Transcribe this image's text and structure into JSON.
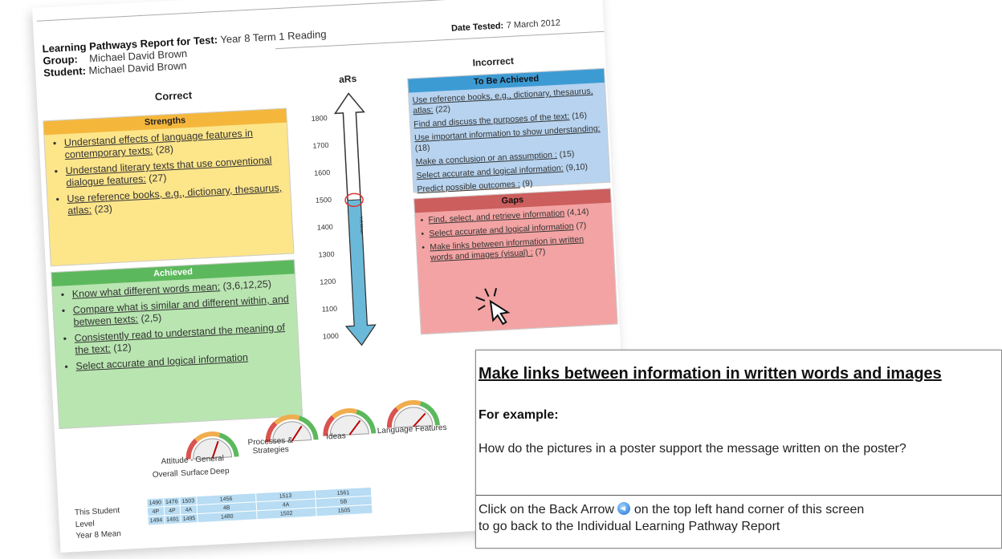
{
  "report": {
    "title_label": "Learning Pathways Report for Test:",
    "title_value": "Year 8 Term 1 Reading",
    "date_label": "Date Tested:",
    "date_value": "7 March 2012",
    "group_label": "Group:",
    "group_value": "Michael David Brown",
    "student_label": "Student:",
    "student_value": "Michael David Brown",
    "correct_heading": "Correct",
    "incorrect_heading": "Incorrect",
    "ars_heading": "aRs",
    "strengths": {
      "title": "Strengths",
      "items": [
        {
          "text": "Understand effects of language features in contemporary texts:",
          "ref": "(28)"
        },
        {
          "text": "Understand literary texts that use conventional dialogue features:",
          "ref": "(27)"
        },
        {
          "text": "Use reference books, e.g., dictionary, thesaurus, atlas:",
          "ref": "(23)"
        }
      ]
    },
    "achieved": {
      "title": "Achieved",
      "items": [
        {
          "text": "Know what different words mean:",
          "ref": "(3,6,12,25)"
        },
        {
          "text": "Compare what is similar and different within, and between texts:",
          "ref": "(2,5)"
        },
        {
          "text": "Consistently read to understand the meaning of the text:",
          "ref": "(12)"
        },
        {
          "text": "Select accurate and logical information",
          "ref": ""
        }
      ]
    },
    "to_be_achieved": {
      "title": "To Be Achieved",
      "items": [
        {
          "text": "Use reference books, e.g., dictionary, thesaurus, atlas:",
          "ref": "(22)"
        },
        {
          "text": "Find and discuss the purposes of the text:",
          "ref": "(16)"
        },
        {
          "text": "Use important information to show understanding:",
          "ref": "(18)"
        },
        {
          "text": "Make a conclusion or an assumption :",
          "ref": "(15)"
        },
        {
          "text": "Select accurate and logical information:",
          "ref": "(9,10)"
        },
        {
          "text": "Predict possible outcomes :",
          "ref": "(9)"
        }
      ]
    },
    "gaps": {
      "title": "Gaps",
      "items": [
        {
          "text": "Find, select, and retrieve information",
          "ref": "(4,14)"
        },
        {
          "text": "Select accurate and logical information",
          "ref": "(7)"
        },
        {
          "text": "Make links between information in written words and images (visual) :",
          "ref": "(7)"
        }
      ]
    },
    "scale_ticks": [
      "1800",
      "1700",
      "1600",
      "1500",
      "1400",
      "1300",
      "1200",
      "1100",
      "1000"
    ],
    "scale_marker": "Yr8 Mean",
    "scale_fill_fraction": 0.66,
    "gauges": [
      {
        "label": "Attitude - General",
        "level": 0.62
      },
      {
        "label": "Processes & Strategies",
        "level": 0.7
      },
      {
        "label": "Ideas",
        "level": 0.72
      },
      {
        "label": "Language Features",
        "level": 0.75
      }
    ],
    "sub_labels": [
      "Overall",
      "Surface",
      "Deep"
    ],
    "row_labels": [
      "This Student",
      "Level",
      "Year 8 Mean"
    ],
    "table": {
      "overall": [
        "1490",
        "4P",
        "1494"
      ],
      "surface": [
        "1476",
        "4P",
        "1491"
      ],
      "deep": [
        "1503",
        "4A",
        "1495"
      ],
      "processes": [
        "1456",
        "4B",
        "1480"
      ],
      "ideas": [
        "1513",
        "4A",
        "1502"
      ],
      "language": [
        "1561",
        "5B",
        "1505"
      ]
    },
    "colors": {
      "strengths": "#fde58a",
      "strengths_title": "#f5b73b",
      "achieved": "#b9e5b1",
      "achieved_title": "#5cb85c",
      "to_be_achieved": "#b7d3ef",
      "to_be_achieved_title": "#3d9bd4",
      "gaps": "#f3a3a3",
      "gaps_title": "#cc5e5e"
    }
  },
  "popup": {
    "title": "Make links between information in written words and images",
    "example_label": "For example:",
    "question": "How do the pictures in a poster support the message written on the poster?",
    "footer_line1_pre": "Click on the Back Arrow",
    "back_icon": "back-arrow-icon",
    "footer_line1_post": "on the top left hand corner of this screen",
    "footer_line2": "to go back to the Individual Learning Pathway Report"
  }
}
